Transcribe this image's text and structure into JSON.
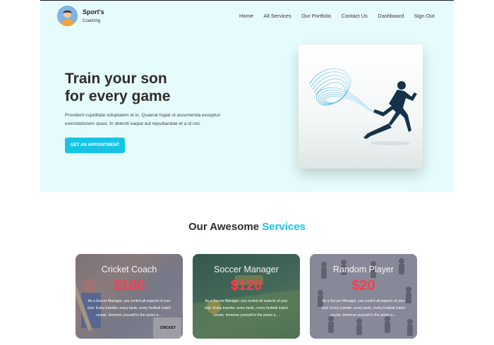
{
  "brand": {
    "title": "Sport's",
    "subtitle": "Coaching"
  },
  "nav": {
    "items": [
      "Home",
      "All Services",
      "Our Portfolio",
      "Contact Us",
      "Dashboard",
      "Sign Out"
    ]
  },
  "hero": {
    "headline_line1": "Train your son",
    "headline_line2": "for every game",
    "description": "Provident cupiditate voluptatem et in. Quaerat fugiat ut assumenda excepturi exercitationem quasi. In deleniti eaque aut repudiandae et a id nisi.",
    "cta_label": "GET AN APPOINTMENT"
  },
  "services": {
    "title_part1": "Our Awesome",
    "title_part2": "Services",
    "cards": [
      {
        "title": "Cricket Coach",
        "price": "$100",
        "text": "As a Soccer Manager, you control all aspects of your club. Every transfer, every tactic, every football match counts. Immerse yourself in the action a....",
        "tag": "CRICKET"
      },
      {
        "title": "Soccer Manager",
        "price": "$120",
        "text": "As a Soccer Manager, you control all aspects of your club. Every transfer, every tactic, every football match counts. Immerse yourself in the action a...."
      },
      {
        "title": "Random Player",
        "price": "$20",
        "text": "As a Soccer Manager, you control all aspects of your club. Every transfer, every tactic, every football match counts. Immerse yourself in the action a...."
      }
    ]
  },
  "colors": {
    "accent": "#16c5e6",
    "hero_background": "#e6fbfc",
    "price_red": "#ff3b4e"
  }
}
